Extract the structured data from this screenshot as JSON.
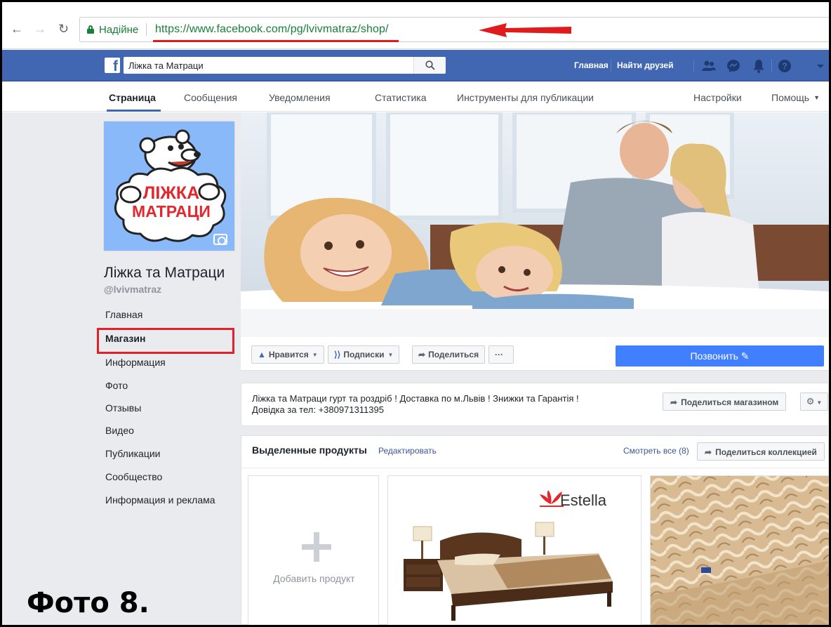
{
  "browser": {
    "secure_label": "Надійне",
    "url": "https://www.facebook.com/pg/lvivmatraz/shop/",
    "annotation_color": "#e01b1b"
  },
  "topbar": {
    "search_value": "Ліжка та Матраци",
    "home_label": "Главная",
    "find_friends_label": "Найти друзей",
    "brand_color": "#4267b2"
  },
  "tabs": {
    "page": "Страница",
    "messages": "Сообщения",
    "notifications": "Уведомления",
    "statistics": "Статистика",
    "publishing_tools": "Инструменты для публикации",
    "settings": "Настройки",
    "help": "Помощь"
  },
  "profile": {
    "logo_line1": "ЛІЖКА",
    "logo_line2": "МАТРАЦИ",
    "name": "Ліжка та Матраци",
    "handle": "@lvivmatraz"
  },
  "sidebar": {
    "items": [
      {
        "label": "Главная"
      },
      {
        "label": "Магазин",
        "active": true
      },
      {
        "label": "Информация"
      },
      {
        "label": "Фото"
      },
      {
        "label": "Отзывы"
      },
      {
        "label": "Видео"
      },
      {
        "label": "Публикации"
      },
      {
        "label": "Сообщество"
      },
      {
        "label": "Информация и реклама"
      }
    ],
    "highlight_color": "#e0202a"
  },
  "actions": {
    "like": "Нравится",
    "follow": "Подписки",
    "share": "Поделиться",
    "more": "···",
    "call": "Позвонить"
  },
  "about": {
    "text": "Ліжка та Матраци гурт та роздріб ! Доставка по м.Львів ! Знижки та Гарантія ! Довідка за тел: +380971311395",
    "share_shop": "Поделиться магазином"
  },
  "featured": {
    "title": "Выделенные продукты",
    "edit": "Редактировать",
    "see_all": "Смотреть все (8)",
    "share_collection": "Поделиться коллекцией",
    "add_product": "Добавить продукт",
    "brand_logo": "Estella"
  },
  "caption": "Фото 8.",
  "accent_call_color": "#4080ff"
}
